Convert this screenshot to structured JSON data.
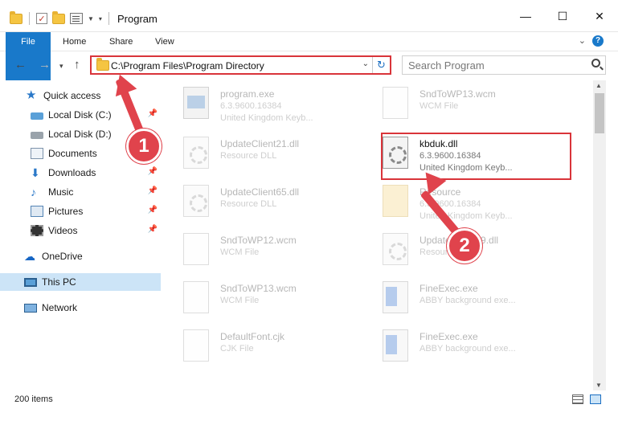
{
  "titlebar": {
    "title": "Program",
    "minimize": "—",
    "maximize": "☐",
    "close": "✕"
  },
  "ribbon": {
    "tabs": [
      "File",
      "Home",
      "Share",
      "View"
    ],
    "help": "?"
  },
  "address": {
    "path": "C:\\Program Files\\Program Directory",
    "search_placeholder": "Search Program"
  },
  "sidebar": {
    "items": [
      {
        "label": "Quick access",
        "icon": "star-icon"
      },
      {
        "label": "Local Disk (C:)",
        "icon": "drive-icon",
        "pinned": true
      },
      {
        "label": "Local Disk (D:)",
        "icon": "drive-icon",
        "pinned": true
      },
      {
        "label": "Documents",
        "icon": "documents-icon",
        "pinned": true
      },
      {
        "label": "Downloads",
        "icon": "download-icon",
        "pinned": true
      },
      {
        "label": "Music",
        "icon": "music-icon",
        "pinned": true
      },
      {
        "label": "Pictures",
        "icon": "pictures-icon",
        "pinned": true
      },
      {
        "label": "Videos",
        "icon": "videos-icon",
        "pinned": true
      },
      {
        "label": "OneDrive",
        "icon": "onedrive-icon"
      },
      {
        "label": "This PC",
        "icon": "pc-icon",
        "selected": true
      },
      {
        "label": "Network",
        "icon": "network-icon"
      }
    ]
  },
  "files": [
    {
      "name": "program.exe",
      "sub1": "6.3.9600.16384",
      "sub2": "United Kingdom Keyb...",
      "icon": "exe-icon"
    },
    {
      "name": "SndToWP13.wcm",
      "sub1": "WCM File",
      "sub2": "",
      "icon": "blank-file-icon"
    },
    {
      "name": "UpdateClient21.dll",
      "sub1": "Resource DLL",
      "sub2": "",
      "icon": "dll-icon"
    },
    {
      "name": "kbduk.dll",
      "sub1": "6.3.9600.16384",
      "sub2": "United Kingdom Keyb...",
      "icon": "dll-icon"
    },
    {
      "name": "UpdateClient65.dll",
      "sub1": "Resource DLL",
      "sub2": "",
      "icon": "dll-icon"
    },
    {
      "name": "Resource",
      "sub1": "6.3.9600.16384",
      "sub2": "United Kingdom Keyb...",
      "icon": "resource-icon"
    },
    {
      "name": "SndToWP12.wcm",
      "sub1": "WCM File",
      "sub2": "",
      "icon": "blank-file-icon"
    },
    {
      "name": "UpdateClient19.dll",
      "sub1": "Resource DLL",
      "sub2": "",
      "icon": "dll-icon"
    },
    {
      "name": "SndToWP13.wcm",
      "sub1": "WCM File",
      "sub2": "",
      "icon": "blank-file-icon"
    },
    {
      "name": "FineExec.exe",
      "sub1": "ABBY background exe...",
      "sub2": "",
      "icon": "fineexec-icon"
    },
    {
      "name": "DefaultFont.cjk",
      "sub1": "CJK File",
      "sub2": "",
      "icon": "blank-file-icon"
    },
    {
      "name": "FineExec.exe",
      "sub1": "ABBY background exe...",
      "sub2": "",
      "icon": "fineexec-icon"
    }
  ],
  "annotations": {
    "step1": "1",
    "step2": "2",
    "color": "#e0434c"
  },
  "status": {
    "count": "200 items"
  }
}
